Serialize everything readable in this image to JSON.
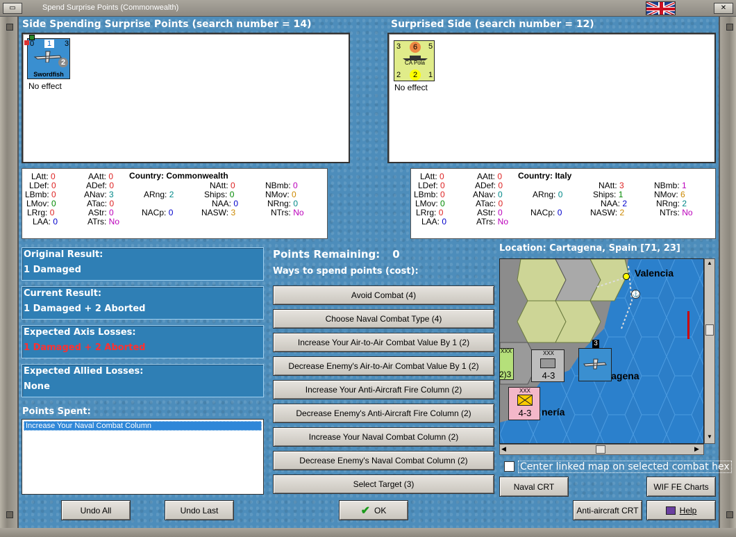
{
  "window": {
    "title": "Spend Surprise Points (Commonwealth)"
  },
  "left": {
    "header": "Side Spending Surprise Points (search number = 14)",
    "unit": {
      "name": "Swordfish",
      "top_left": "0",
      "top_mid": "1",
      "top_right": "3",
      "bottom_mid": "2",
      "effect": "No effect"
    }
  },
  "right": {
    "header": "Surprised Side (search number = 12)",
    "unit": {
      "name": "CA Pola",
      "top_left": "3",
      "top_mid": "6",
      "top_right": "5",
      "bottom_left": "2",
      "bottom_mid": "2",
      "bottom_right": "1",
      "effect": "No effect"
    }
  },
  "stats_left": {
    "country_label": "Country:",
    "country": "Commonwealth",
    "rows": [
      [
        "LAtt:",
        "0",
        "AAtt:",
        "0",
        "",
        "",
        "NAtt:",
        "0",
        "NBmb:",
        "0"
      ],
      [
        "LDef:",
        "0",
        "ADef:",
        "0",
        "",
        "",
        "",
        "",
        "NBmb:",
        ""
      ],
      [
        "LBmb:",
        "0",
        "ANav:",
        "3",
        "ARng:",
        "2",
        "Ships:",
        "0",
        "NMov:",
        "0"
      ],
      [
        "LMov:",
        "0",
        "ATac:",
        "0",
        "",
        "",
        "NAA:",
        "0",
        "NRng:",
        "0"
      ],
      [
        "LRrg:",
        "0",
        "AStr:",
        "0",
        "NACp:",
        "0",
        "NASW:",
        "3",
        "NTrs:",
        "No"
      ],
      [
        "LAA:",
        "0",
        "ATrs:",
        "No",
        "",
        "",
        "",
        "",
        "",
        ""
      ]
    ]
  },
  "stats_right": {
    "country_label": "Country:",
    "country": "Italy"
  },
  "results": {
    "original_label": "Original Result:",
    "original": "1 Damaged",
    "current_label": "Current Result:",
    "current": "1 Damaged + 2 Aborted",
    "axis_label": "Expected Axis Losses:",
    "axis": "1 Damaged + 2 Aborted",
    "allied_label": "Expected Allied Losses:",
    "allied": "None"
  },
  "points_spent": {
    "label": "Points Spent:",
    "items": [
      "Increase Your Naval Combat Column"
    ]
  },
  "points": {
    "remaining_label": "Points Remaining:",
    "remaining": "0",
    "ways_label": "Ways to spend points (cost):"
  },
  "actions": [
    "Avoid Combat (4)",
    "Choose Naval Combat Type (4)",
    "Increase Your Air-to-Air Combat Value By 1 (2)",
    "Decrease Enemy's Air-to-Air Combat Value By 1 (2)",
    "Increase Your Anti-Aircraft Fire Column (2)",
    "Decrease Enemy's Anti-Aircraft Fire Column (2)",
    "Increase Your Naval Combat Column (2)",
    "Decrease Enemy's Naval Combat Column (2)",
    "Select Target (3)"
  ],
  "map": {
    "location": "Location: Cartagena, Spain [71, 23]",
    "city1": "Valencia",
    "city2": "rtagena",
    "city3": "nería",
    "stack_count": "3",
    "unit_a_name": "4-3",
    "unit_b_name": "4-3",
    "unit_c": "2)3",
    "xxx": "XXX",
    "centre_label": "Center linked map on selected combat hex"
  },
  "buttons": {
    "undo_all": "Undo All",
    "undo_last": "Undo Last",
    "ok": "OK",
    "naval_crt": "Naval CRT",
    "wif_fe": "WIF FE Charts",
    "aa_crt": "Anti-aircraft CRT",
    "help": "Help"
  }
}
